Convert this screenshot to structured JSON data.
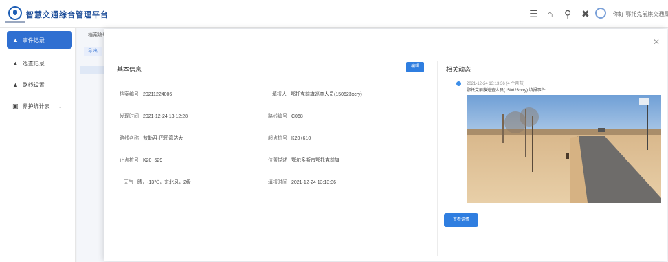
{
  "header": {
    "app_title": "智慧交通综合管理平台",
    "icons": [
      "menu-icon",
      "home-icon",
      "search-icon",
      "fullscreen-icon",
      "user-avatar-icon"
    ],
    "user_name": "你好 鄂托克前旗交通局"
  },
  "sidebar": {
    "items": [
      {
        "label": "事件记录",
        "icon": "warning-triangle-icon",
        "active": true
      },
      {
        "label": "巡查记录",
        "icon": "warning-triangle-icon",
        "active": false
      },
      {
        "label": "路线设置",
        "icon": "warning-triangle-icon",
        "active": false
      },
      {
        "label": "养护统计表",
        "icon": "chart-icon",
        "active": false
      }
    ]
  },
  "background": {
    "tab": "档案编号",
    "button": "导 出"
  },
  "modal": {
    "basic_title": "基本信息",
    "edit_button": "编辑",
    "fields_left": [
      {
        "label": "档案编号",
        "value": "20211224006"
      },
      {
        "label": "发现时间",
        "value": "2021-12-24 13:12:28"
      },
      {
        "label": "路线名称",
        "value": "敖勒召-巴图湾达大"
      },
      {
        "label": "止点桩号",
        "value": "K20+629"
      },
      {
        "label": "天气",
        "value": "晴，-13℃，东北风，2级"
      }
    ],
    "fields_right": [
      {
        "label": "填报人",
        "value": "鄂托克前旗巡查人员(150623xcry)"
      },
      {
        "label": "路线编号",
        "value": "C068"
      },
      {
        "label": "起点桩号",
        "value": "K20+610"
      },
      {
        "label": "位置描述",
        "value": "鄂尔多斯市鄂托克前旗"
      },
      {
        "label": "填报时间",
        "value": "2021-12-24 13:13:36"
      }
    ],
    "dynamic_title": "相关动态",
    "timeline": {
      "time": "2021-12-24 13:13:36 (4 个月前)",
      "text": "鄂托克前旗巡查人员(150623xcry) 填报事件"
    },
    "detail_button": "查看详情"
  }
}
